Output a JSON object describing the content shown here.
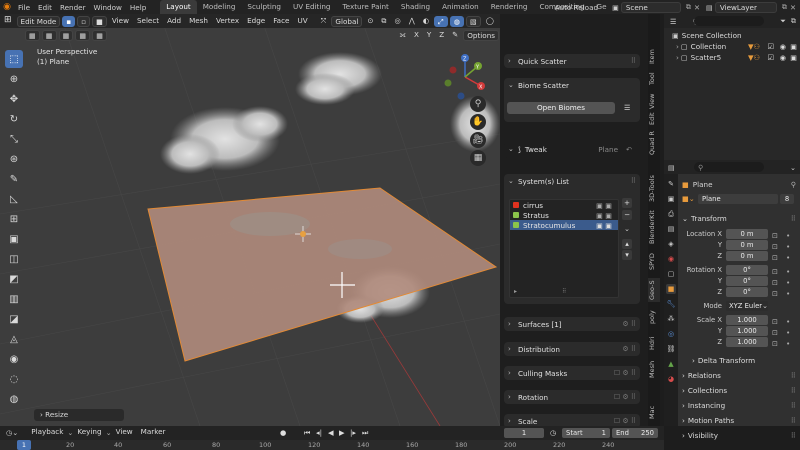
{
  "menu": [
    "File",
    "Edit",
    "Render",
    "Window",
    "Help"
  ],
  "workspaces": [
    "Layout",
    "Modeling",
    "Sculpting",
    "UV Editing",
    "Texture Paint",
    "Shading",
    "Animation",
    "Rendering",
    "Compositing",
    "Ge"
  ],
  "active_workspace": "Layout",
  "top_right": {
    "auto_reload": "Auto Reload",
    "scene": "Scene",
    "view_layer": "ViewLayer"
  },
  "viewport_header": {
    "mode": "Edit Mode",
    "menus": [
      "View",
      "Select",
      "Add",
      "Mesh",
      "Vertex",
      "Edge",
      "Face",
      "UV"
    ],
    "orientation": "Global",
    "axes": [
      "X",
      "Y",
      "Z"
    ],
    "options": "Options"
  },
  "viewport_info": {
    "perspective": "User Perspective",
    "object": "(1) Plane"
  },
  "gizmo": {
    "x": "X",
    "y": "Y",
    "z": "Z"
  },
  "resize_panel": "Resize",
  "addon": {
    "quick_scatter": "Quick Scatter",
    "biome_scatter": "Biome Scatter",
    "open_biomes": "Open Biomes",
    "tweak": "Tweak",
    "tweak_target": "Plane",
    "systems_list": "System(s) List",
    "systems": [
      {
        "name": "cirrus",
        "color": "#e0321f"
      },
      {
        "name": "Stratus",
        "color": "#8bc34a"
      },
      {
        "name": "Stratocumulus",
        "color": "#8bc34a"
      }
    ],
    "surfaces": "Surfaces [1]",
    "distribution": "Distribution",
    "culling_masks": "Culling Masks",
    "rotation": "Rotation",
    "scale": "Scale"
  },
  "side_tabs": [
    "Item",
    "Tool",
    "View",
    "Edit",
    "Quad R",
    "3D-Tools",
    "BlenderKit",
    "SPYD",
    "Geo-S",
    "poly",
    "Hdri",
    "Mesh",
    "Mac"
  ],
  "outliner": {
    "scene_collection": "Scene Collection",
    "collection": "Collection",
    "scatter": "Scatter5"
  },
  "properties": {
    "object_name": "Plane",
    "mesh_name": "Plane",
    "users": "8",
    "transform": "Transform",
    "location_label": "Location X",
    "location": [
      "0 m",
      "0 m",
      "0 m"
    ],
    "rotation_label": "Rotation X",
    "rotation": [
      "0°",
      "0°",
      "0°"
    ],
    "mode_label": "Mode",
    "mode": "XYZ Euler",
    "scale_label": "Scale X",
    "scale": [
      "1.000",
      "1.000",
      "1.000"
    ],
    "y": "Y",
    "z": "Z",
    "delta_transform": "Delta Transform",
    "sections": [
      "Relations",
      "Collections",
      "Instancing",
      "Motion Paths",
      "Visibility"
    ]
  },
  "timeline": {
    "menus": [
      "Playback",
      "Keying",
      "View",
      "Marker"
    ],
    "current_frame": "1",
    "start_label": "Start",
    "start": "1",
    "end_label": "End",
    "end": "250",
    "ticks": [
      "20",
      "40",
      "60",
      "80",
      "100",
      "120",
      "140",
      "160",
      "180",
      "200",
      "220",
      "240"
    ],
    "frame_indicator": "1"
  }
}
